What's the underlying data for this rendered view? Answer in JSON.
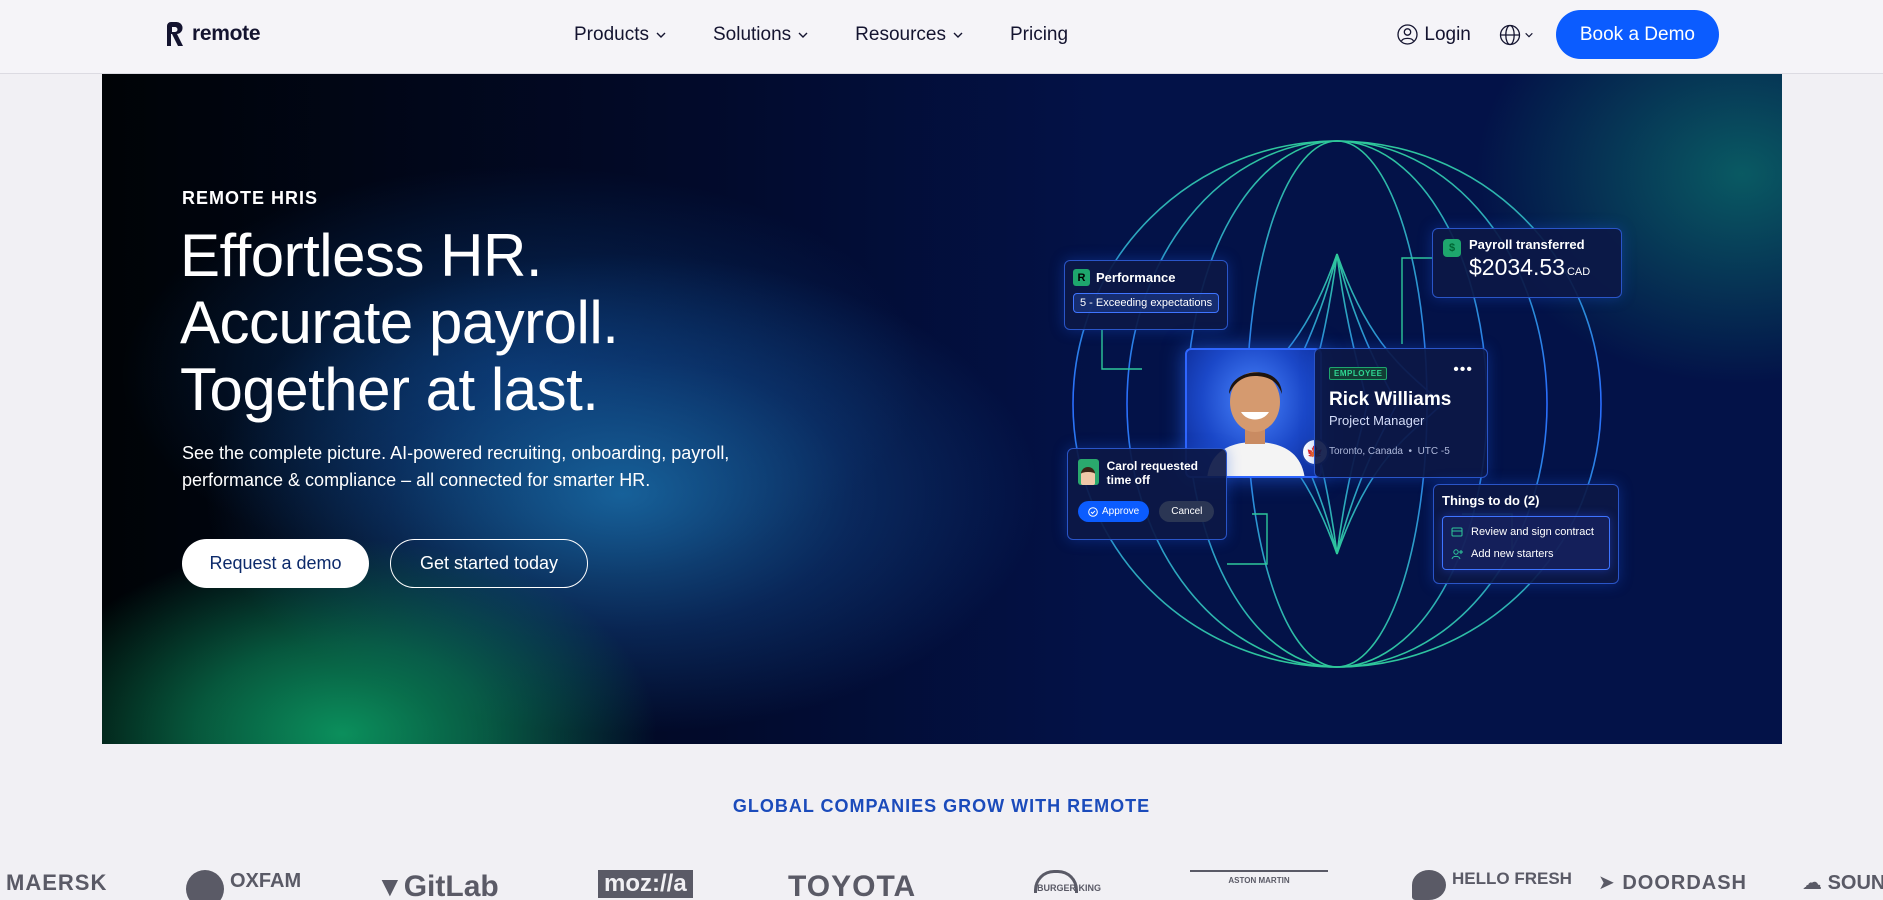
{
  "nav": {
    "brand": "remote",
    "items": [
      {
        "label": "Products"
      },
      {
        "label": "Solutions"
      },
      {
        "label": "Resources"
      },
      {
        "label": "Pricing"
      }
    ],
    "login": "Login",
    "cta": "Book a Demo"
  },
  "hero": {
    "eyebrow": "REMOTE HRIS",
    "headline": [
      "Effortless HR.",
      "Accurate payroll.",
      "Together at last."
    ],
    "subtext": "See the complete picture. AI-powered recruiting, onboarding, payroll, performance & compliance – all connected for smarter HR.",
    "primary_button": "Request a demo",
    "secondary_button": "Get started today",
    "performance": {
      "title": "Performance",
      "value": "5 - Exceeding expectations",
      "badge": "R"
    },
    "payroll": {
      "title": "Payroll transferred",
      "amount": "$2034.53",
      "currency": "CAD"
    },
    "employee": {
      "badge": "EMPLOYEE",
      "name": "Rick Williams",
      "role": "Project Manager",
      "location": "Toronto, Canada",
      "timezone": "UTC -5"
    },
    "time_off": {
      "text": "Carol requested time off",
      "approve": "Approve",
      "cancel": "Cancel"
    },
    "todo": {
      "title": "Things to do (2)",
      "items": [
        "Review and sign contract",
        "Add new starters"
      ]
    }
  },
  "customers": {
    "tagline": "GLOBAL COMPANIES GROW WITH REMOTE",
    "logos": [
      "MAERSK",
      "OXFAM",
      "GitLab",
      "moz://a",
      "TOYOTA",
      "BURGER KING",
      "ASTON MARTIN",
      "HELLO FRESH",
      "DOORDASH",
      "SOUND"
    ]
  },
  "colors": {
    "accent": "#0b5cff",
    "green": "#1ea66d",
    "hero_bg": "#031248"
  }
}
